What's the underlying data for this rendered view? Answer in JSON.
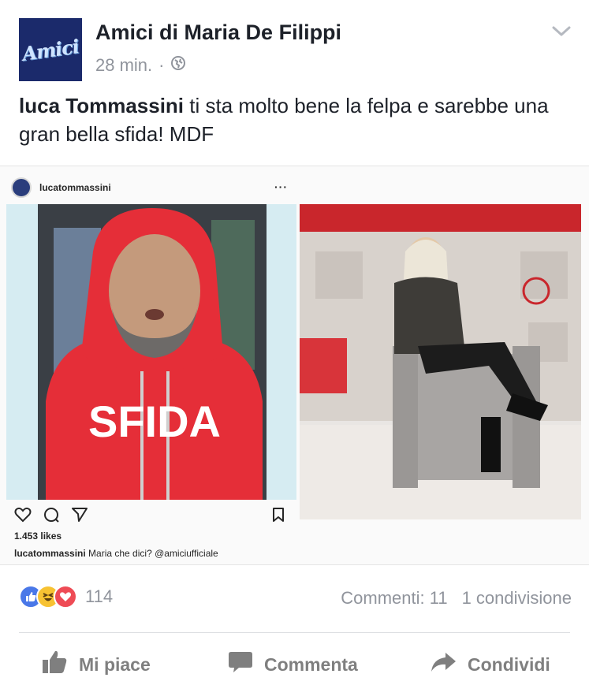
{
  "header": {
    "page_name": "Amici di Maria De Filippi",
    "avatar_logo_text": "Amici",
    "timestamp": "28 min.",
    "separator": "·",
    "privacy_icon": "globe-icon",
    "menu_icon": "chevron-down-icon"
  },
  "post": {
    "mention": "luca Tommassini",
    "text": " ti sta molto bene la felpa e sarebbe una gran bella sfida! MDF"
  },
  "instagram": {
    "username": "lucatommassini",
    "menu_dots": "···",
    "sweatshirt_text": "SFIDA",
    "likes": "1.453 likes",
    "caption_user": "lucatommassini",
    "caption_text": " Maria che dici? @amiciufficiale"
  },
  "reactions": {
    "types": [
      "like",
      "haha",
      "love"
    ],
    "count": "114",
    "comments": "Commenti: 11",
    "shares": "1 condivisione"
  },
  "actions": {
    "like_label": "Mi piace",
    "comment_label": "Commenta",
    "share_label": "Condividi"
  },
  "colors": {
    "like_blue": "#4a78e8",
    "haha_yellow": "#f7c232",
    "love_red": "#ee4b55",
    "hoodie_red": "#e52e38",
    "muted_gray": "#90949c"
  }
}
